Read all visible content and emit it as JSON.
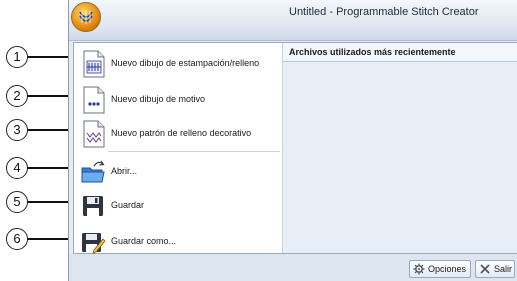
{
  "callouts": [
    "1",
    "2",
    "3",
    "4",
    "5",
    "6"
  ],
  "window": {
    "title": "Untitled - Programmable Stitch Creator"
  },
  "menu": {
    "items": [
      {
        "label": "Nuevo dibujo de estampación/relleno",
        "icon": "new-stamp-fill-pattern-icon"
      },
      {
        "label": "Nuevo dibujo de motivo",
        "icon": "new-motif-pattern-icon"
      },
      {
        "label": "Nuevo patrón de relleno decorativo",
        "icon": "new-decorative-fill-icon"
      },
      {
        "label": "Abrir...",
        "icon": "open-folder-icon"
      },
      {
        "label": "Guardar",
        "icon": "save-disk-icon"
      },
      {
        "label": "Guardar como...",
        "icon": "save-as-icon"
      }
    ]
  },
  "recent": {
    "header": "Archivos utilizados más recientemente",
    "files": []
  },
  "footer": {
    "options_label": "Opciones",
    "exit_label": "Salir"
  },
  "colors": {
    "accent": "#2a3a9a",
    "panel": "#e8eef6",
    "border": "#9aaac0"
  }
}
